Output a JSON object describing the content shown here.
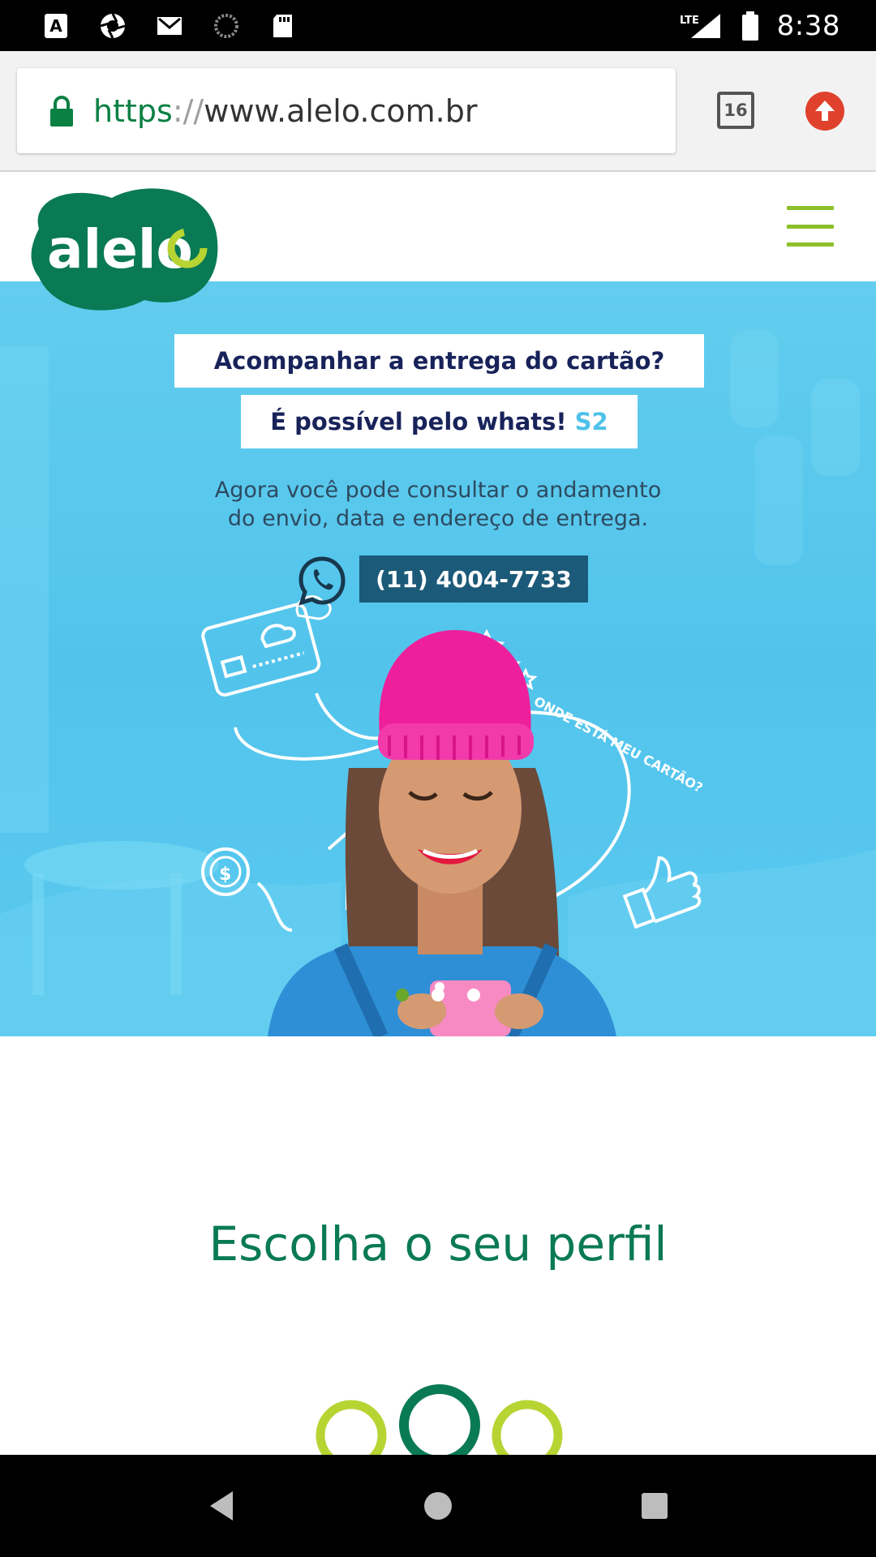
{
  "status_bar": {
    "time": "8:38",
    "network": "LTE",
    "icons": [
      "a-keyboard-icon",
      "aperture-icon",
      "gmail-icon",
      "loading-icon",
      "sd-card-icon"
    ]
  },
  "browser": {
    "url_scheme": "https",
    "url_separator": "://",
    "url_host": "www.alelo.com.br",
    "tab_count": "16"
  },
  "site": {
    "logo_text": "alelo",
    "brand_colors": {
      "green": "#0a7a54",
      "lime": "#8dbf2a"
    }
  },
  "banner": {
    "headline_1": "Acompanhar a entrega do cartão?",
    "headline_2": "É possível pelo whats!",
    "headline_2_accent": "S2",
    "subtext_line_1": "Agora você pode consultar o andamento",
    "subtext_line_2": "do envio, data e endereço de entrega.",
    "phone": "(11) 4004-7733",
    "curve_text": "ONDE ESTÁ MEU CARTÃO?",
    "carousel_total": 3,
    "carousel_active": 1
  },
  "profile": {
    "title": "Escolha o seu perfil"
  }
}
